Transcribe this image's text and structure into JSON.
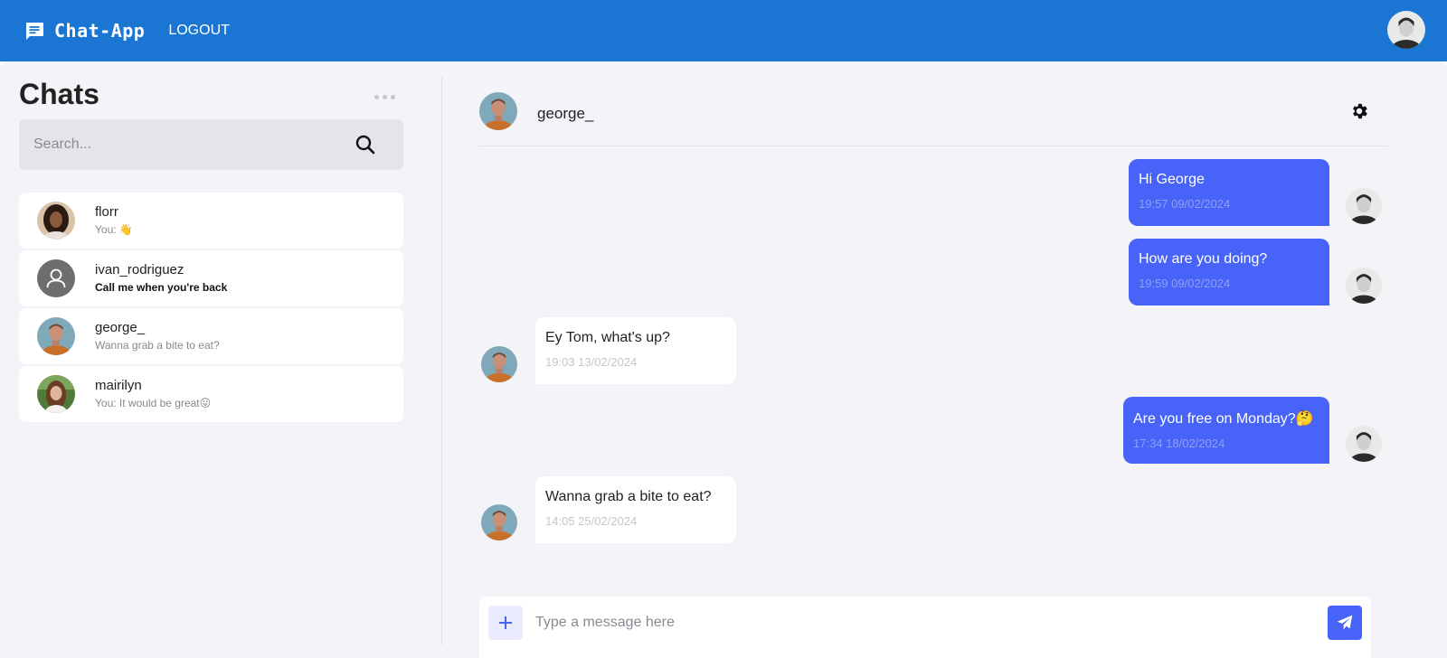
{
  "topbar": {
    "brand_icon": "chat-bubble-icon",
    "brand_name": "Chat-App",
    "logout_label": "LOGOUT",
    "color": "#1b76d3"
  },
  "sidebar": {
    "title": "Chats",
    "search_placeholder": "Search...",
    "chats": [
      {
        "name": "florr",
        "preview": "You: 👋",
        "unread": false
      },
      {
        "name": "ivan_rodriguez",
        "preview": "Call me when you're back",
        "unread": true
      },
      {
        "name": "george_",
        "preview": "Wanna grab a bite to eat?",
        "unread": false
      },
      {
        "name": "mairilyn",
        "preview": "You: It would be great😛",
        "unread": false
      }
    ]
  },
  "conversation": {
    "contact_name": "george_",
    "messages": [
      {
        "direction": "out",
        "text": "Hi George",
        "time": "19:57 09/02/2024"
      },
      {
        "direction": "out",
        "text": "How are you doing?",
        "time": "19:59 09/02/2024"
      },
      {
        "direction": "in",
        "text": "Ey Tom, what's up?",
        "time": "19:03 13/02/2024"
      },
      {
        "direction": "out",
        "text": "Are you free on Monday?🤔",
        "time": "17:34 18/02/2024"
      },
      {
        "direction": "in",
        "text": "Wanna grab a bite to eat?",
        "time": "14:05 25/02/2024"
      }
    ],
    "composer_placeholder": "Type a message here"
  },
  "colors": {
    "outgoing_bubble": "#4763f8",
    "incoming_bubble": "#ffffff",
    "panel_bg": "#f3f3f8"
  }
}
